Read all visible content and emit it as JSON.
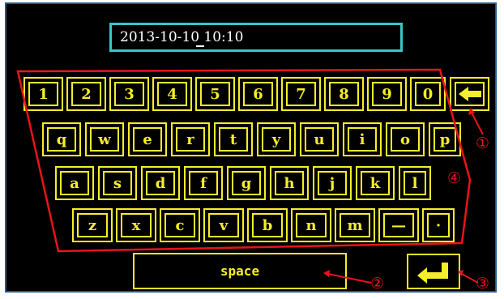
{
  "display": {
    "text": "2013-10-10 10:10",
    "cursor_char": "_"
  },
  "keyboard": {
    "row1": [
      "1",
      "2",
      "3",
      "4",
      "5",
      "6",
      "7",
      "8",
      "9",
      "0"
    ],
    "row2": [
      "q",
      "w",
      "e",
      "r",
      "t",
      "y",
      "u",
      "i",
      "o",
      "p"
    ],
    "row3": [
      "a",
      "s",
      "d",
      "f",
      "g",
      "h",
      "j",
      "k",
      "l"
    ],
    "row4": [
      "z",
      "x",
      "c",
      "v",
      "b",
      "n",
      "m",
      "—",
      "·"
    ],
    "space_label": "space",
    "backspace_icon": "left-arrow-icon",
    "enter_icon": "enter-arrow-icon"
  },
  "annotations": {
    "markers": [
      "①",
      "②",
      "③",
      "④"
    ],
    "color": "#e8141a"
  },
  "colors": {
    "key": "#f5ee2a",
    "display_border": "#38c6c9",
    "background": "#000000",
    "frame": "#1f5d8f"
  }
}
